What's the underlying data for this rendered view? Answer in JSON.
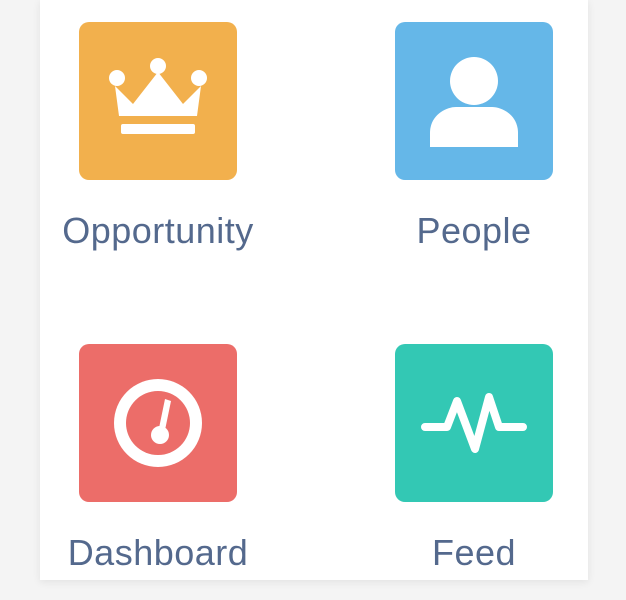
{
  "tiles": [
    {
      "label": "Opportunity",
      "icon": "crown-icon",
      "color": "#f2b04d"
    },
    {
      "label": "People",
      "icon": "person-icon",
      "color": "#65b7e8"
    },
    {
      "label": "Dashboard",
      "icon": "speedometer-icon",
      "color": "#ec6d69"
    },
    {
      "label": "Feed",
      "icon": "pulse-icon",
      "color": "#33c8b4"
    }
  ]
}
